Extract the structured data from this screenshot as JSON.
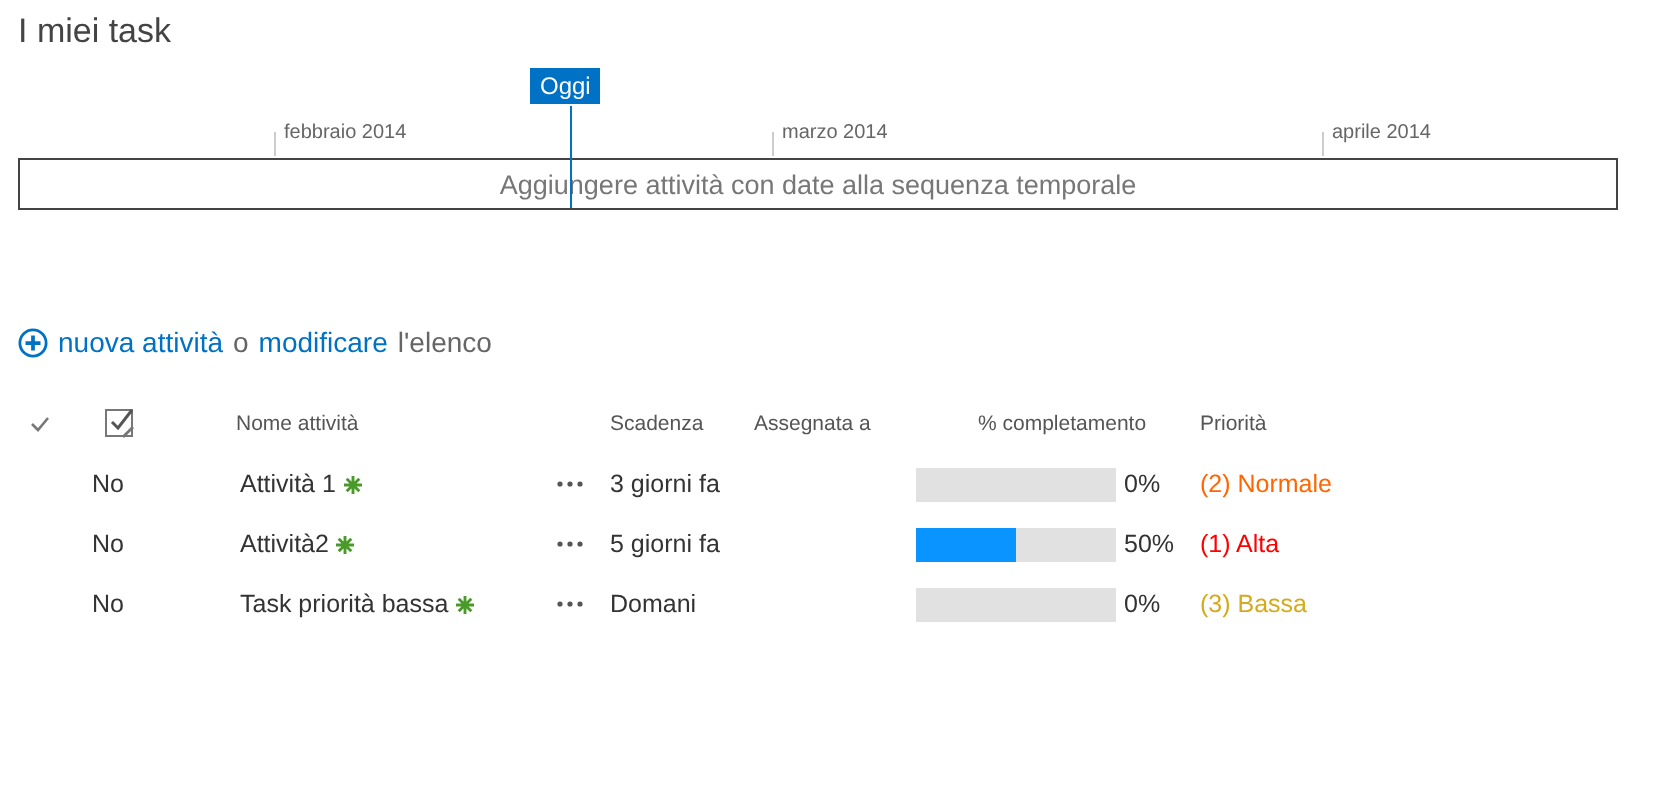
{
  "page": {
    "title": "I miei task"
  },
  "timeline": {
    "today_label": "Oggi",
    "placeholder": "Aggiungere attività con date alla sequenza temporale",
    "months": [
      "febbraio 2014",
      "marzo 2014",
      "aprile 2014"
    ]
  },
  "command_bar": {
    "new_link": "nuova attività",
    "joiner": "o",
    "edit_link": "modificare",
    "suffix": "l'elenco"
  },
  "table": {
    "columns": [
      "Nome attività",
      "Scadenza",
      "Assegnata a",
      "% completamento",
      "Priorità"
    ],
    "rows": [
      {
        "completed": "No",
        "name": "Attività 1",
        "new": true,
        "due": "3 giorni fa",
        "percent": "0%",
        "priority": "(2) Normale",
        "color": "#ff6600"
      },
      {
        "completed": "No",
        "name": "Attività2",
        "new": true,
        "due": "5 giorni fa",
        "level": 0.5,
        "percent": "50%",
        "priority": "(1) Alta",
        "color": "#ff0000"
      },
      {
        "completed": "No",
        "name": "Task priorità bassa",
        "new": true,
        "due": "Domani",
        "percent": "0%",
        "priority": "(3) Bassa",
        "color": "#d4aa1e"
      }
    ]
  }
}
